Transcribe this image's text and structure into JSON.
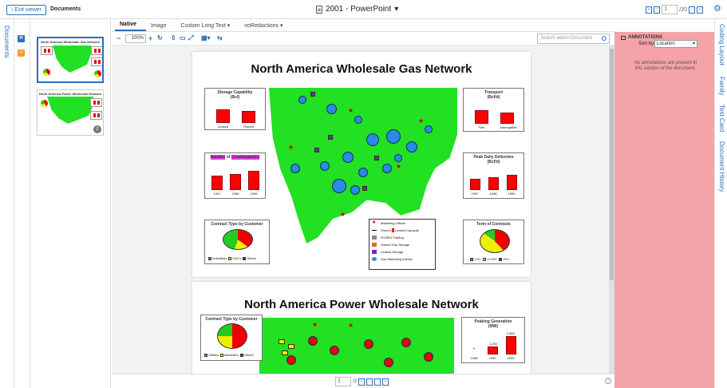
{
  "topbar": {
    "exit_label": "Exit viewer",
    "documents_label": "Documents",
    "doc_title": "2001 - PowerPoint",
    "page_current": "1",
    "page_total": "/20"
  },
  "left_rail": {
    "documents_tab": "Documents"
  },
  "viewer_tabs": [
    {
      "label": "Native",
      "active": true
    },
    {
      "label": "Image"
    },
    {
      "label": "Custom Long Text"
    },
    {
      "label": "noRedactions"
    }
  ],
  "toolbar": {
    "zoom_value": "100%",
    "search_placeholder": "Search within Document"
  },
  "thumbnails": [
    {
      "title": "North America Wholesale Gas Network"
    },
    {
      "title": "North America Power Wholesale Network",
      "badge": "2"
    }
  ],
  "slide1": {
    "title": "North America Wholesale Gas Network",
    "storage": {
      "title": "Storage Capability",
      "unit": "(Bcf)",
      "labels": [
        "Leased",
        "Owned"
      ]
    },
    "transport": {
      "title": "Transport",
      "unit": "(Bcf/d)",
      "labels": [
        "Firm",
        "Interruptible"
      ]
    },
    "counterparties": {
      "title_a": "Number",
      "title_b": " of ",
      "title_c": "Counterparties",
      "years": [
        "1997",
        "1998",
        "1999"
      ]
    },
    "deliveries": {
      "title": "Peak Daily Deliveries",
      "unit": "(Bcf/d)",
      "years": [
        "1997",
        "1998",
        "1999"
      ]
    },
    "contract_type": {
      "title": "Contract Type by Customer",
      "legend": [
        "Industrials",
        "LDC's",
        "Others"
      ]
    },
    "term": {
      "title": "Term of Contracts",
      "legend": [
        "<1Yr",
        ">1<5Yr",
        ">5Yr"
      ]
    },
    "legend": [
      "Marketing Offices",
      "Owned",
      "Leased Capacity",
      "NYMEX Trading",
      "Owned Gas Storage",
      "Leased Storage",
      "Gas Marketing Activity"
    ]
  },
  "slide2": {
    "title": "North America Power Wholesale Network",
    "contract_type": {
      "title": "Contract Type by Customer",
      "legend": [
        "Utilities",
        "Marketers",
        "Others"
      ]
    },
    "peaking": {
      "title": "Peaking Generation",
      "unit": "(MW)",
      "years": [
        "1998",
        "1999",
        "2000"
      ],
      "values": [
        "0",
        "1,200",
        "2,800"
      ]
    }
  },
  "bottom": {
    "page_current": "1",
    "page_total": "/2"
  },
  "annotations": {
    "header": "ANNOTATIONS",
    "sort_label": "Sort by:",
    "sort_value": "Location",
    "empty_message": "No annotations are present in this section of the document."
  },
  "right_rail": [
    "Coding Layout",
    "Family",
    "Test Card",
    "Document History"
  ],
  "colors": {
    "accent": "#2a6ebb",
    "annotation_bg": "#f4a3a8",
    "map_green": "#22e022"
  }
}
